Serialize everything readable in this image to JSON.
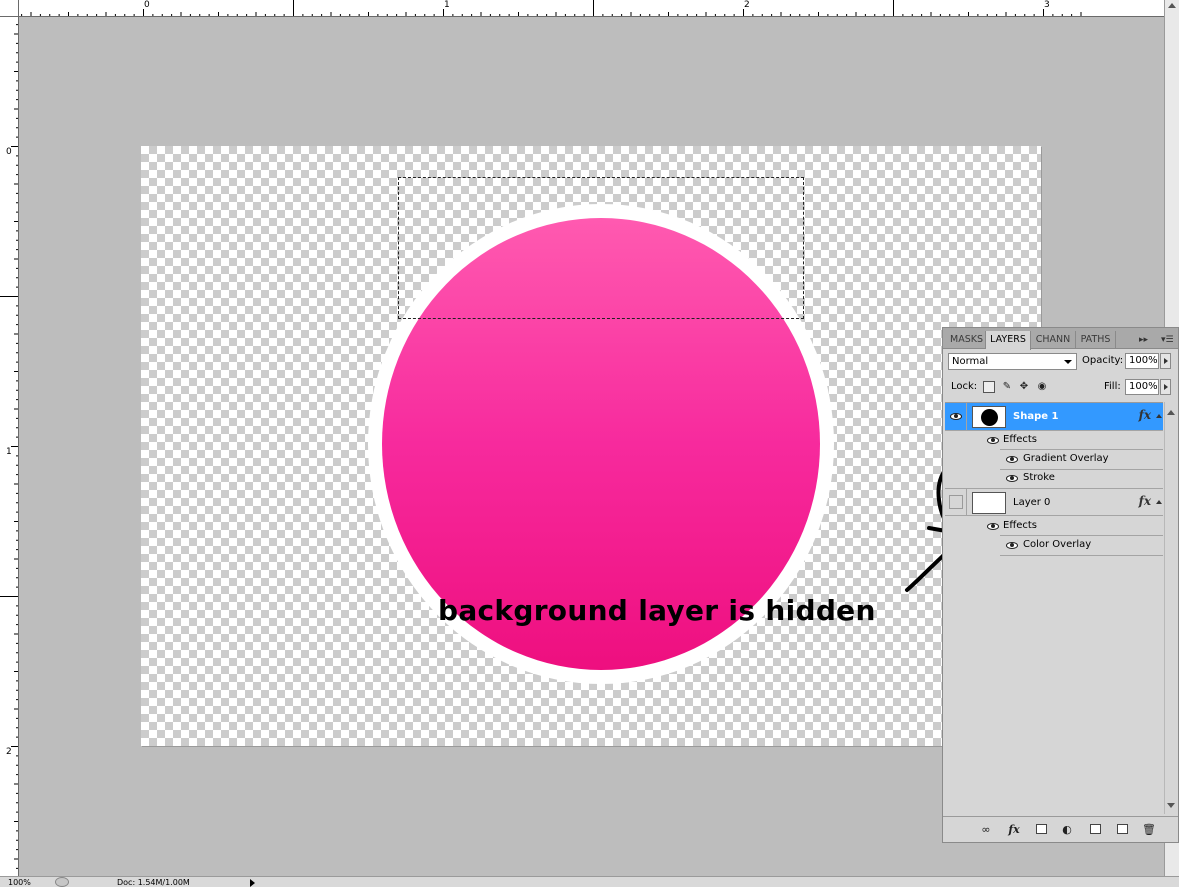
{
  "rulers": {
    "top_labels": [
      "0",
      "1",
      "2",
      "3"
    ],
    "left_labels": [
      "0",
      "1",
      "2"
    ]
  },
  "canvas": {
    "annotation_text": "background layer is hidden"
  },
  "layers_panel": {
    "tabs": [
      "MASKS",
      "LAYERS",
      "CHANN",
      "PATHS"
    ],
    "active_tab": "LAYERS",
    "blend_mode": "Normal",
    "opacity_label": "Opacity:",
    "opacity_value": "100%",
    "lock_label": "Lock:",
    "fill_label": "Fill:",
    "fill_value": "100%",
    "fx_glyph": "fx",
    "layers": [
      {
        "name": "Shape 1",
        "selected": true,
        "visible": true,
        "effects_label": "Effects",
        "effects": [
          "Gradient Overlay",
          "Stroke"
        ]
      },
      {
        "name": "Layer 0",
        "selected": false,
        "visible": false,
        "effects_label": "Effects",
        "effects": [
          "Color Overlay"
        ]
      }
    ]
  },
  "statusbar": {
    "zoom": "100%",
    "doc_info": "Doc: 1.54M/1.00M"
  },
  "colors": {
    "selection": "#3399ff",
    "circle_top": "#ff5ab0",
    "circle_bottom": "#ee0f7f",
    "workspace": "#bdbdbd"
  }
}
